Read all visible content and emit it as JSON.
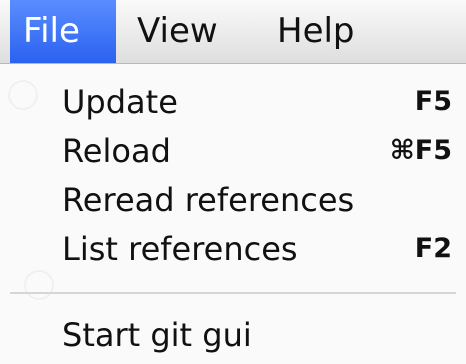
{
  "menubar": {
    "items": [
      {
        "label": "File",
        "active": true
      },
      {
        "label": "View",
        "active": false
      },
      {
        "label": "Help",
        "active": false
      }
    ]
  },
  "file_menu": {
    "items": [
      {
        "label": "Update",
        "shortcut": "F5"
      },
      {
        "label": "Reload",
        "shortcut": "⌘F5"
      },
      {
        "label": "Reread references",
        "shortcut": ""
      },
      {
        "label": "List references",
        "shortcut": "F2"
      },
      {
        "label": "Start git gui",
        "shortcut": ""
      }
    ]
  },
  "colors": {
    "active_menu": "#2f6af2",
    "menu_background": "#fafafa",
    "separator": "#d6d6d6",
    "text": "#111111"
  }
}
